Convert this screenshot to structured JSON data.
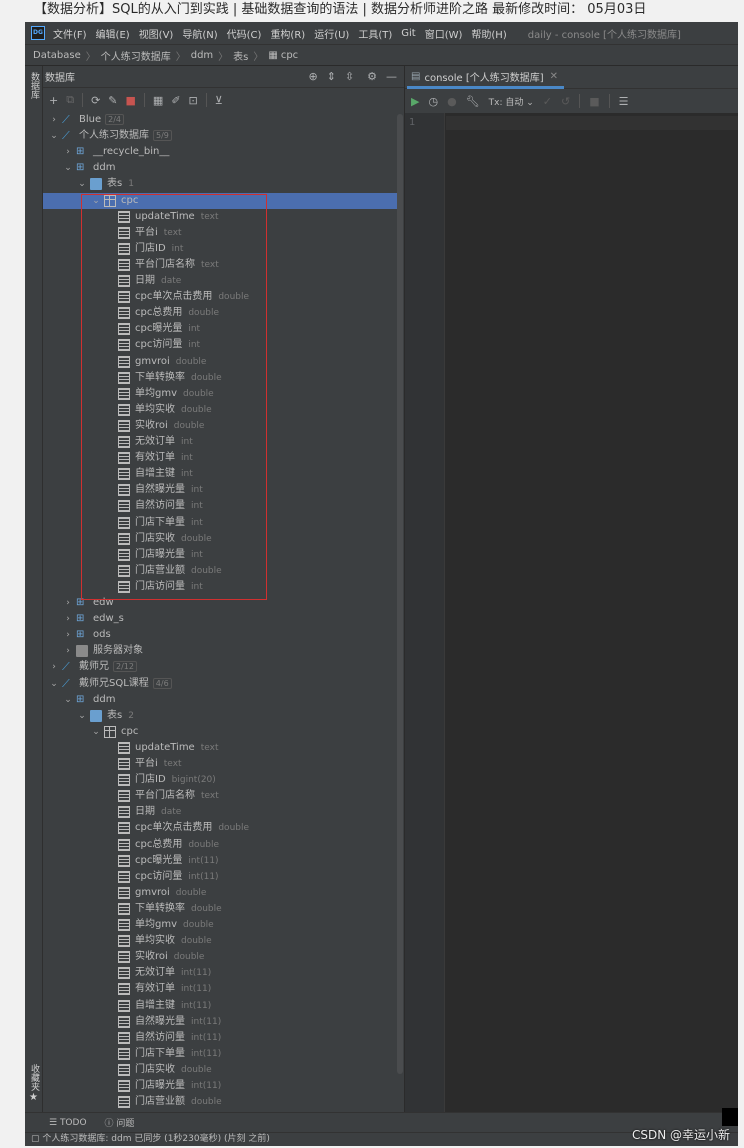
{
  "top_strip_text": "【数据分析】SQL的从入门到实践 | 基础数据查询的语法 | 数据分析师进阶之路  最新修改时间： 05月03日",
  "menubar": {
    "logo": "DG",
    "items": [
      "文件(F)",
      "编辑(E)",
      "视图(V)",
      "导航(N)",
      "代码(C)",
      "重构(R)",
      "运行(U)",
      "工具(T)",
      "Git",
      "窗口(W)",
      "帮助(H)"
    ],
    "window_title": "daily - console [个人练习数据库]"
  },
  "breadcrumb": [
    "Database",
    "个人练习数据库",
    "ddm",
    "表s",
    "cpc"
  ],
  "side_tabs": {
    "database": "数据库",
    "favorites": "收藏夹"
  },
  "db_panel": {
    "title": "数据库",
    "scroll_thumb_pos": "top"
  },
  "tree": [
    {
      "name": "Blue",
      "meta": "2/4",
      "kind": "datasource",
      "arrow": "closed",
      "level": 0
    },
    {
      "name": "个人练习数据库",
      "meta": "5/9",
      "kind": "datasource",
      "arrow": "open",
      "level": 0
    },
    {
      "name": "__recycle_bin__",
      "meta": "",
      "kind": "schema",
      "arrow": "closed",
      "level": 1
    },
    {
      "name": "ddm",
      "meta": "",
      "kind": "schema",
      "arrow": "open",
      "level": 1
    },
    {
      "name": "表s",
      "meta": "1",
      "kind": "folder",
      "arrow": "open",
      "level": 2
    },
    {
      "name": "cpc",
      "meta": "",
      "kind": "table",
      "arrow": "open",
      "level": 3,
      "selected": true
    },
    {
      "name": "updateTime",
      "meta": "text",
      "kind": "column",
      "level": 4
    },
    {
      "name": "平台i",
      "meta": "text",
      "kind": "column",
      "level": 4
    },
    {
      "name": "门店ID",
      "meta": "int",
      "kind": "column",
      "level": 4
    },
    {
      "name": "平台门店名称",
      "meta": "text",
      "kind": "column",
      "level": 4
    },
    {
      "name": "日期",
      "meta": "date",
      "kind": "column",
      "level": 4
    },
    {
      "name": "cpc单次点击费用",
      "meta": "double",
      "kind": "column",
      "level": 4
    },
    {
      "name": "cpc总费用",
      "meta": "double",
      "kind": "column",
      "level": 4
    },
    {
      "name": "cpc曝光量",
      "meta": "int",
      "kind": "column",
      "level": 4
    },
    {
      "name": "cpc访问量",
      "meta": "int",
      "kind": "column",
      "level": 4
    },
    {
      "name": "gmvroi",
      "meta": "double",
      "kind": "column",
      "level": 4
    },
    {
      "name": "下单转换率",
      "meta": "double",
      "kind": "column",
      "level": 4
    },
    {
      "name": "单均gmv",
      "meta": "double",
      "kind": "column",
      "level": 4
    },
    {
      "name": "单均实收",
      "meta": "double",
      "kind": "column",
      "level": 4
    },
    {
      "name": "实收roi",
      "meta": "double",
      "kind": "column",
      "level": 4
    },
    {
      "name": "无效订单",
      "meta": "int",
      "kind": "column",
      "level": 4
    },
    {
      "name": "有效订单",
      "meta": "int",
      "kind": "column",
      "level": 4
    },
    {
      "name": "自增主键",
      "meta": "int",
      "kind": "column",
      "level": 4
    },
    {
      "name": "自然曝光量",
      "meta": "int",
      "kind": "column",
      "level": 4
    },
    {
      "name": "自然访问量",
      "meta": "int",
      "kind": "column",
      "level": 4
    },
    {
      "name": "门店下单量",
      "meta": "int",
      "kind": "column",
      "level": 4
    },
    {
      "name": "门店实收",
      "meta": "double",
      "kind": "column",
      "level": 4
    },
    {
      "name": "门店曝光量",
      "meta": "int",
      "kind": "column",
      "level": 4
    },
    {
      "name": "门店营业额",
      "meta": "double",
      "kind": "column",
      "level": 4
    },
    {
      "name": "门店访问量",
      "meta": "int",
      "kind": "column",
      "level": 4
    },
    {
      "name": "edw",
      "meta": "",
      "kind": "schema",
      "arrow": "closed",
      "level": 1
    },
    {
      "name": "edw_s",
      "meta": "",
      "kind": "schema",
      "arrow": "closed",
      "level": 1
    },
    {
      "name": "ods",
      "meta": "",
      "kind": "schema",
      "arrow": "closed",
      "level": 1
    },
    {
      "name": "服务器对象",
      "meta": "",
      "kind": "server",
      "arrow": "closed",
      "level": 1
    },
    {
      "name": "戴师兄",
      "meta": "2/12",
      "kind": "datasource",
      "arrow": "closed",
      "level": 0
    },
    {
      "name": "戴师兄SQL课程",
      "meta": "4/6",
      "kind": "datasource",
      "arrow": "open",
      "level": 0
    },
    {
      "name": "ddm",
      "meta": "",
      "kind": "schema",
      "arrow": "open",
      "level": 1
    },
    {
      "name": "表s",
      "meta": "2",
      "kind": "folder",
      "arrow": "open",
      "level": 2
    },
    {
      "name": "cpc",
      "meta": "",
      "kind": "table",
      "arrow": "open",
      "level": 3
    },
    {
      "name": "updateTime",
      "meta": "text",
      "kind": "column",
      "level": 4
    },
    {
      "name": "平台i",
      "meta": "text",
      "kind": "column",
      "level": 4
    },
    {
      "name": "门店ID",
      "meta": "bigint(20)",
      "kind": "column",
      "level": 4
    },
    {
      "name": "平台门店名称",
      "meta": "text",
      "kind": "column",
      "level": 4
    },
    {
      "name": "日期",
      "meta": "date",
      "kind": "column",
      "level": 4
    },
    {
      "name": "cpc单次点击费用",
      "meta": "double",
      "kind": "column",
      "level": 4
    },
    {
      "name": "cpc总费用",
      "meta": "double",
      "kind": "column",
      "level": 4
    },
    {
      "name": "cpc曝光量",
      "meta": "int(11)",
      "kind": "column",
      "level": 4
    },
    {
      "name": "cpc访问量",
      "meta": "int(11)",
      "kind": "column",
      "level": 4
    },
    {
      "name": "gmvroi",
      "meta": "double",
      "kind": "column",
      "level": 4
    },
    {
      "name": "下单转换率",
      "meta": "double",
      "kind": "column",
      "level": 4
    },
    {
      "name": "单均gmv",
      "meta": "double",
      "kind": "column",
      "level": 4
    },
    {
      "name": "单均实收",
      "meta": "double",
      "kind": "column",
      "level": 4
    },
    {
      "name": "实收roi",
      "meta": "double",
      "kind": "column",
      "level": 4
    },
    {
      "name": "无效订单",
      "meta": "int(11)",
      "kind": "column",
      "level": 4
    },
    {
      "name": "有效订单",
      "meta": "int(11)",
      "kind": "column",
      "level": 4
    },
    {
      "name": "自增主键",
      "meta": "int(11)",
      "kind": "column",
      "level": 4
    },
    {
      "name": "自然曝光量",
      "meta": "int(11)",
      "kind": "column",
      "level": 4
    },
    {
      "name": "自然访问量",
      "meta": "int(11)",
      "kind": "column",
      "level": 4
    },
    {
      "name": "门店下单量",
      "meta": "int(11)",
      "kind": "column",
      "level": 4
    },
    {
      "name": "门店实收",
      "meta": "double",
      "kind": "column",
      "level": 4
    },
    {
      "name": "门店曝光量",
      "meta": "int(11)",
      "kind": "column",
      "level": 4
    },
    {
      "name": "门店营业额",
      "meta": "double",
      "kind": "column",
      "level": 4
    }
  ],
  "editor": {
    "tab_label": "console [个人练习数据库]",
    "tx_label": "Tx: 自动",
    "line_number": "1"
  },
  "bottom_tabs": {
    "todo": "TODO",
    "problems": "问题"
  },
  "status": "个人练习数据库: ddm 已同步 (1秒230毫秒) (片刻 之前)",
  "watermark": "CSDN @幸运小新",
  "colors": {
    "selection": "#4b6eaf",
    "highlight_box": "#d03030",
    "accent_tab": "#4a88c7",
    "run": "#59a869"
  }
}
